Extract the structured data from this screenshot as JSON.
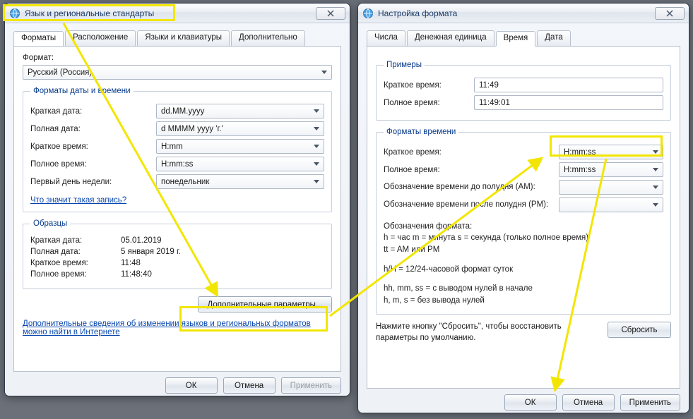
{
  "windows": {
    "left": {
      "title": "Язык и региональные стандарты",
      "tabs": [
        "Форматы",
        "Расположение",
        "Языки и клавиатуры",
        "Дополнительно"
      ],
      "format_label": "Формат:",
      "format_value": "Русский (Россия)",
      "dt_group": "Форматы даты и времени",
      "rows": {
        "short_date": {
          "label": "Краткая дата:",
          "value": "dd.MM.yyyy"
        },
        "long_date": {
          "label": "Полная дата:",
          "value": "d MMMM yyyy 'г.'"
        },
        "short_time": {
          "label": "Краткое время:",
          "value": "H:mm"
        },
        "long_time": {
          "label": "Полное время:",
          "value": "H:mm:ss"
        },
        "first_day": {
          "label": "Первый день недели:",
          "value": "понедельник"
        }
      },
      "what_link": "Что значит такая запись?",
      "samples_group": "Образцы",
      "samples": {
        "short_date": {
          "label": "Краткая дата:",
          "value": "05.01.2019"
        },
        "long_date": {
          "label": "Полная дата:",
          "value": "5 января 2019 г."
        },
        "short_time": {
          "label": "Краткое время:",
          "value": "11:48"
        },
        "long_time": {
          "label": "Полное время:",
          "value": "11:48:40"
        }
      },
      "extra_btn": "Дополнительные параметры...",
      "more_link": "Дополнительные сведения об изменении языков и региональных форматов можно найти в Интернете",
      "buttons": {
        "ok": "ОК",
        "cancel": "Отмена",
        "apply": "Применить"
      }
    },
    "right": {
      "title": "Настройка формата",
      "tabs": [
        "Числа",
        "Денежная единица",
        "Время",
        "Дата"
      ],
      "examples_group": "Примеры",
      "examples": {
        "short": {
          "label": "Краткое время:",
          "value": "11:49"
        },
        "long": {
          "label": "Полное время:",
          "value": "11:49:01"
        }
      },
      "formats_group": "Форматы времени",
      "formats": {
        "short": {
          "label": "Краткое время:",
          "value": "H:mm:ss"
        },
        "long": {
          "label": "Полное время:",
          "value": "H:mm:ss"
        },
        "am": {
          "label": "Обозначение времени до полудня (AM):",
          "value": ""
        },
        "pm": {
          "label": "Обозначение времени после полудня (PM):",
          "value": ""
        }
      },
      "notation_title": "Обозначения формата:",
      "notation_line1": "h = час   m = минута   s = секунда (только полное время)",
      "notation_line2": "tt = AM или PM",
      "notation_line3": "h/H = 12/24-часовой формат суток",
      "notation_line4": "hh, mm, ss =  с выводом нулей в начале",
      "notation_line5": "h, m, s = без вывода нулей",
      "reset_hint": "Нажмите кнопку \"Сбросить\", чтобы восстановить параметры по умолчанию.",
      "reset_btn": "Сбросить",
      "buttons": {
        "ok": "ОК",
        "cancel": "Отмена",
        "apply": "Применить"
      }
    }
  }
}
